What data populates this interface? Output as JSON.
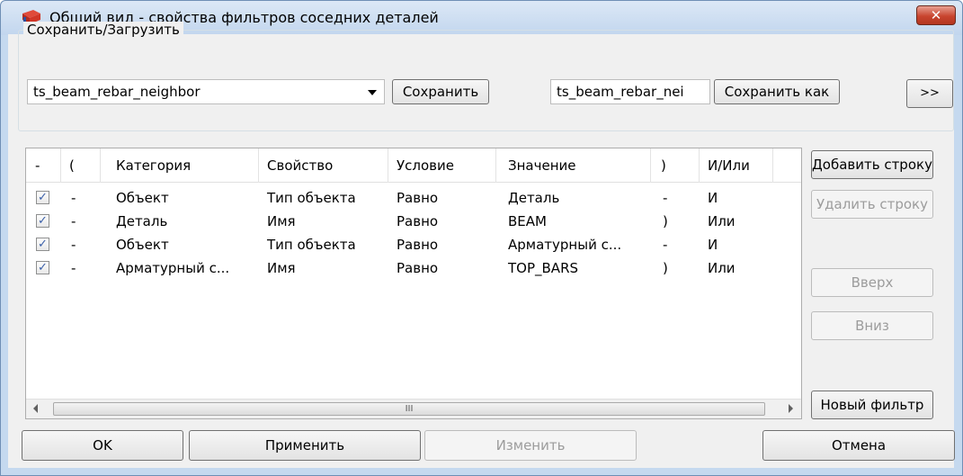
{
  "window": {
    "title": "Общий вид - свойства фильтров соседних деталей",
    "close_symbol": "✕"
  },
  "save_load": {
    "label": "Сохранить/Загрузить",
    "selected_filter": "ts_beam_rebar_neighbor",
    "save_button": "Сохранить",
    "save_as_name": "ts_beam_rebar_nei",
    "save_as_button": "Сохранить как",
    "more_button": ">>"
  },
  "table": {
    "columns": [
      "-",
      "(",
      "Категория",
      "Свойство",
      "Условие",
      "Значение",
      ")",
      "И/Или"
    ],
    "rows": [
      {
        "checked": true,
        "open": "-",
        "category": "Объект",
        "property": "Тип объекта",
        "condition": "Равно",
        "value": "Деталь",
        "close": "-",
        "logic": "И"
      },
      {
        "checked": true,
        "open": "-",
        "category": "Деталь",
        "property": "Имя",
        "condition": "Равно",
        "value": "BEAM",
        "close": ")",
        "logic": "Или"
      },
      {
        "checked": true,
        "open": "-",
        "category": "Объект",
        "property": "Тип объекта",
        "condition": "Равно",
        "value": "Арматурный с...",
        "close": "-",
        "logic": "И"
      },
      {
        "checked": true,
        "open": "-",
        "category": "Арматурный с...",
        "property": "Имя",
        "condition": "Равно",
        "value": "TOP_BARS",
        "close": ")",
        "logic": "Или"
      }
    ],
    "scroll_thumb_grip": "III"
  },
  "side_buttons": {
    "add_row": "Добавить строку",
    "delete_row": "Удалить строку",
    "up": "Вверх",
    "down": "Вниз",
    "new_filter": "Новый фильтр"
  },
  "bottom_buttons": {
    "ok": "OK",
    "apply": "Применить",
    "modify": "Изменить",
    "cancel": "Отмена"
  },
  "colors": {
    "title_bar": "#c5d9ef",
    "close_button": "#c8452f",
    "disabled_text": "#9c9c9c"
  }
}
